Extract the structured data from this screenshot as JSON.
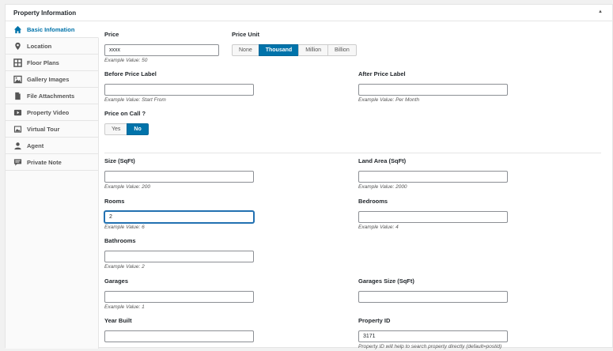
{
  "panel": {
    "title": "Property Information",
    "toggle_icon": "triangle-up-icon"
  },
  "sidebar": {
    "items": [
      {
        "label": "Basic Infomation",
        "icon": "home-icon",
        "active": true
      },
      {
        "label": "Location",
        "icon": "map-pin-icon"
      },
      {
        "label": "Floor Plans",
        "icon": "floor-plan-icon"
      },
      {
        "label": "Gallery Images",
        "icon": "gallery-icon"
      },
      {
        "label": "File Attachments",
        "icon": "file-icon"
      },
      {
        "label": "Property Video",
        "icon": "video-icon"
      },
      {
        "label": "Virtual Tour",
        "icon": "virtual-tour-icon"
      },
      {
        "label": "Agent",
        "icon": "agent-icon"
      },
      {
        "label": "Private Note",
        "icon": "note-icon"
      }
    ]
  },
  "form": {
    "price": {
      "label": "Price",
      "value": "xxxx",
      "example": "Example Value: 50"
    },
    "price_unit": {
      "label": "Price Unit",
      "options": [
        "None",
        "Thousand",
        "Million",
        "Billion"
      ],
      "selected": "Thousand"
    },
    "before_price_label": {
      "label": "Before Price Label",
      "value": "",
      "example": "Example Value: Start From"
    },
    "after_price_label": {
      "label": "After Price Label",
      "value": "",
      "example": "Example Value: Per Month"
    },
    "price_on_call": {
      "label": "Price on Call ?",
      "options": [
        "Yes",
        "No"
      ],
      "selected": "No"
    },
    "size": {
      "label": "Size (SqFt)",
      "value": "",
      "example": "Example Value: 200"
    },
    "land_area": {
      "label": "Land Area (SqFt)",
      "value": "",
      "example": "Example Value: 2000"
    },
    "rooms": {
      "label": "Rooms",
      "value": "2",
      "example": "Example Value: 6"
    },
    "bedrooms": {
      "label": "Bedrooms",
      "value": "",
      "example": "Example Value: 4"
    },
    "bathrooms": {
      "label": "Bathrooms",
      "value": "",
      "example": "Example Value: 2"
    },
    "garages": {
      "label": "Garages",
      "value": "",
      "example": "Example Value: 1"
    },
    "garages_size": {
      "label": "Garages Size (SqFt)",
      "value": ""
    },
    "year_built": {
      "label": "Year Built",
      "value": ""
    },
    "property_id": {
      "label": "Property ID",
      "value": "3171",
      "example": "Property ID will help to search property directly (default=postid)"
    }
  },
  "colors": {
    "accent": "#0073aa",
    "focus": "#2271b1"
  }
}
